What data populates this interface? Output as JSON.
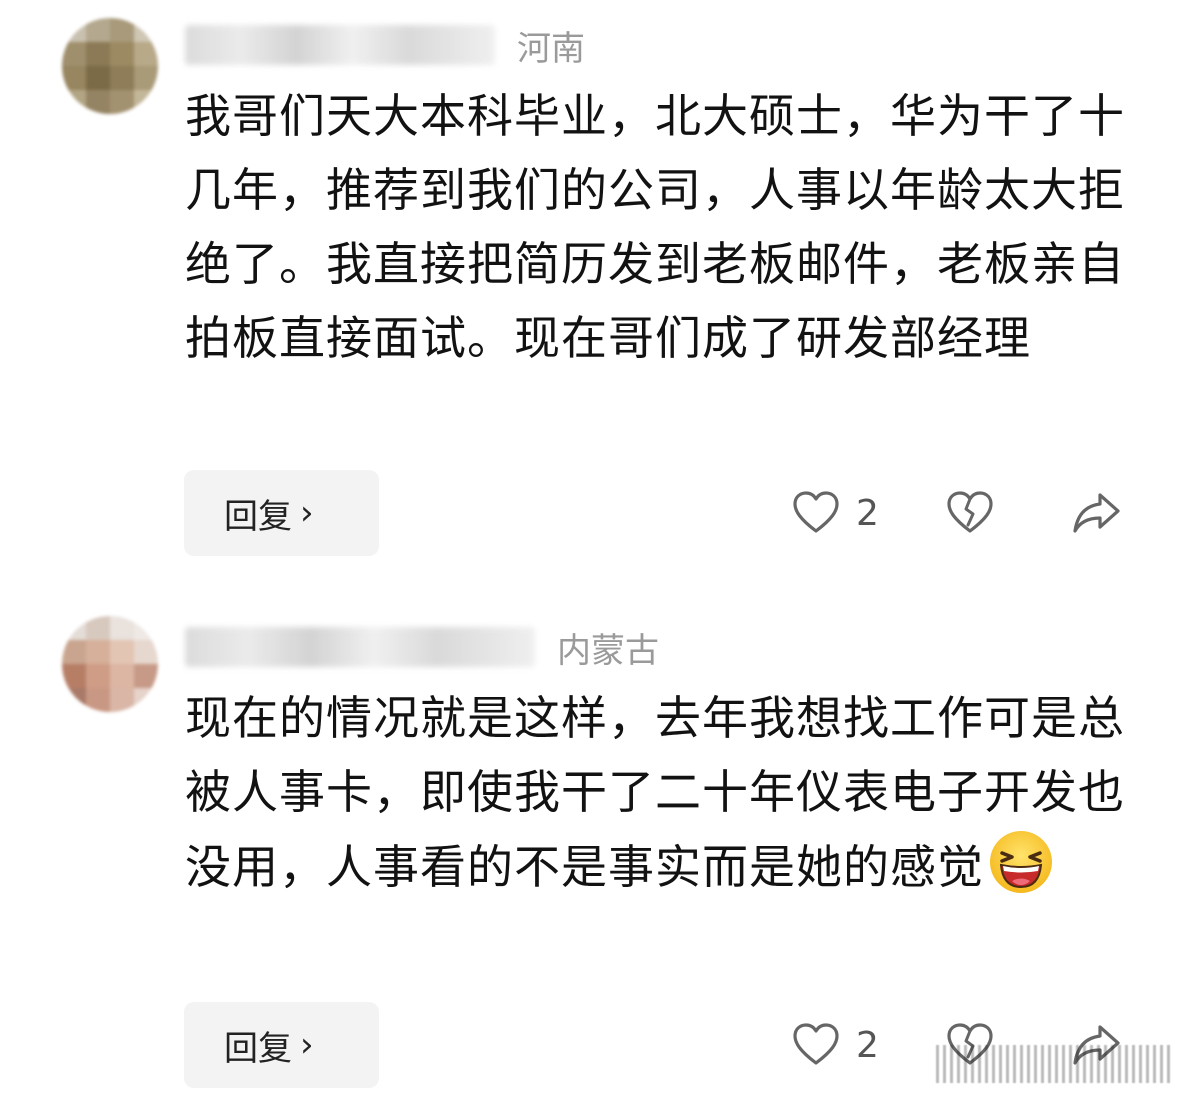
{
  "comments": [
    {
      "region": "河南",
      "text": "我哥们天大本科毕业，北大硕士，华为干了十几年，推荐到我们的公司，人事以年龄太大拒绝了。我直接把简历发到老板邮件，老板亲自拍板直接面试。现在哥们成了研发部经理",
      "reply_label": "回复",
      "like_count": "2"
    },
    {
      "region": "内蒙古",
      "text": "现在的情况就是这样，去年我想找工作可是总被人事卡，即使我干了二十年仪表电子开发也没用，人事看的不是事实而是她的感觉",
      "emoji": "laughing-face-emoji",
      "reply_label": "回复",
      "like_count": "2"
    }
  ],
  "icons": {
    "like": "heart-icon",
    "dislike": "broken-heart-icon",
    "share": "share-arrow-icon",
    "reply_chevron": "chevron-right-icon"
  },
  "colors": {
    "text": "#121212",
    "region": "#9a9a9a",
    "button_bg": "#f3f3f3",
    "icon": "#666666"
  }
}
